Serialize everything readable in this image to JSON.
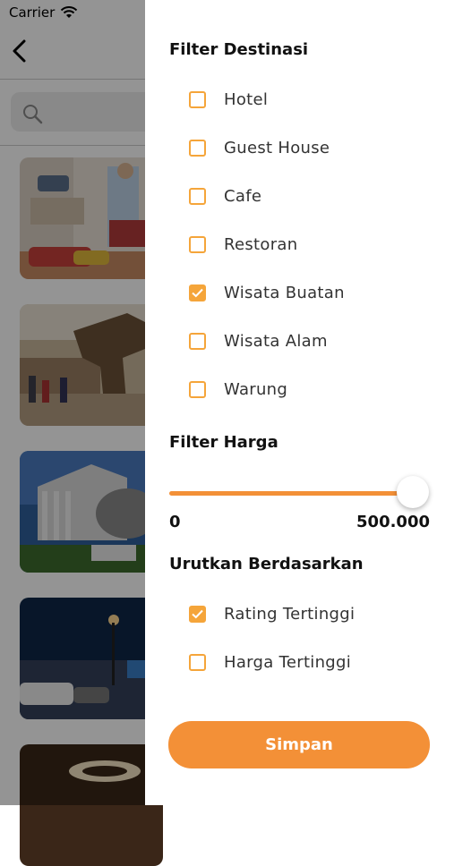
{
  "status": {
    "carrier": "Carrier"
  },
  "filter_destinasi": {
    "title": "Filter Destinasi",
    "options": [
      {
        "label": "Hotel",
        "checked": false
      },
      {
        "label": "Guest House",
        "checked": false
      },
      {
        "label": "Cafe",
        "checked": false
      },
      {
        "label": "Restoran",
        "checked": false
      },
      {
        "label": "Wisata Buatan",
        "checked": true
      },
      {
        "label": "Wisata Alam",
        "checked": false
      },
      {
        "label": "Warung",
        "checked": false
      }
    ]
  },
  "filter_harga": {
    "title": "Filter Harga",
    "min_label": "0",
    "max_label": "500.000",
    "level_fraction": 1.0
  },
  "urutkan": {
    "title": "Urutkan Berdasarkan",
    "options": [
      {
        "label": "Rating Tertinggi",
        "checked": true
      },
      {
        "label": "Harga Tertinggi",
        "checked": false
      }
    ]
  },
  "save_label": "Simpan",
  "colors": {
    "accent": "#F39037",
    "checkbox": "#F5A53A"
  }
}
